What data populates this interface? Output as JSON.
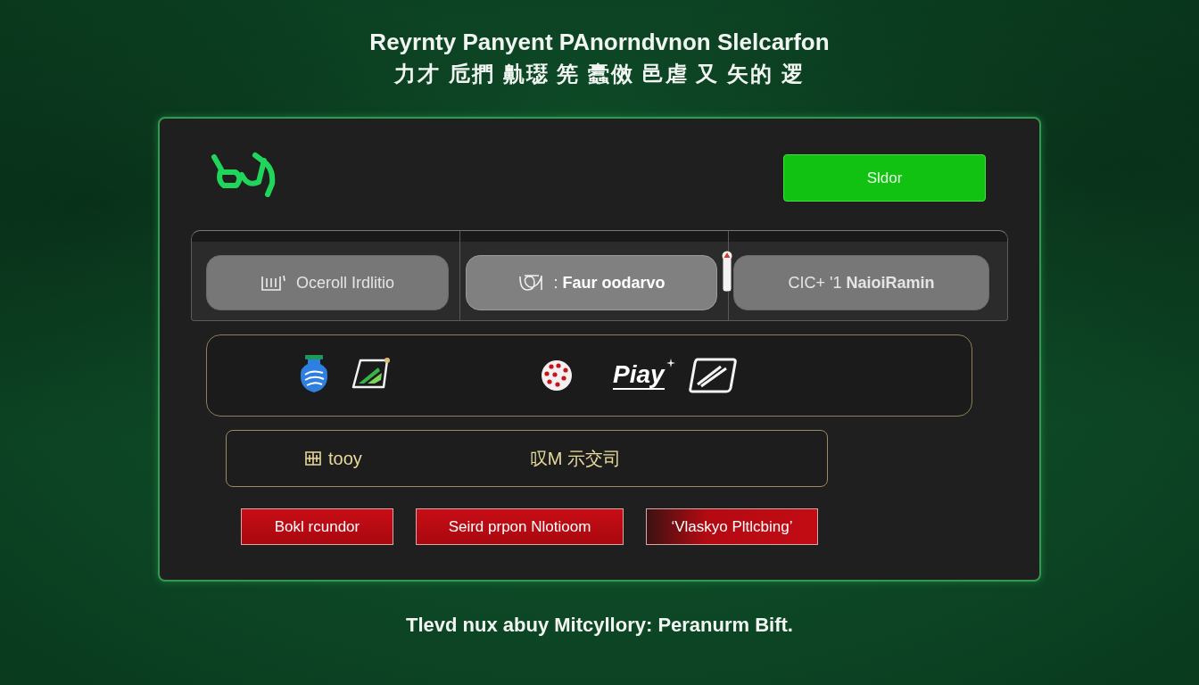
{
  "heading": {
    "title": "Reyrnty Panyent PAnorndvnon Slelcarfon",
    "subtitle": "力才 卮捫 鼽璱 筅 蠹傚 邑虐 又 矢的 逻"
  },
  "card": {
    "primary_button": "Sldor",
    "tabs": [
      {
        "kind": "frame",
        "label": "Oceroll Irdlitio",
        "selected": false
      },
      {
        "kind": "knot",
        "label": ": **Faur oodarvo**",
        "selected": true
      },
      {
        "kind": "plain",
        "label": "CIC+ '1 **NaioiRamin**",
        "selected": false
      }
    ],
    "payment_methods": {
      "wordmark": "Piay"
    },
    "input_field": {
      "texts": [
        "tooy",
        "叹M 示交司"
      ]
    },
    "actions": [
      {
        "kind": "solid",
        "label": "Bokl rcundor"
      },
      {
        "kind": "solid",
        "label": "Seird prpon Nlotioom"
      },
      {
        "kind": "fade",
        "label": "‘Vlaskyo Pltlcbing’"
      }
    ]
  },
  "footer": "Tlevd nux abuy Mitcyllory: Peranurm Bift."
}
